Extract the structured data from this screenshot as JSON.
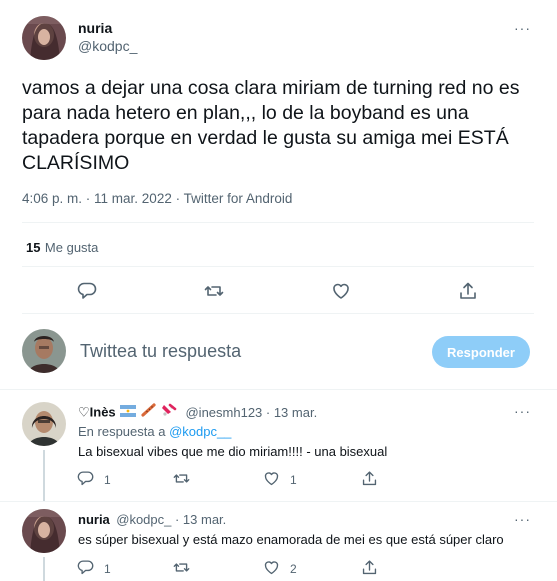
{
  "main_tweet": {
    "author_name": "nuria",
    "author_handle": "@kodpc_",
    "more": "···",
    "text": "vamos a dejar una cosa clara miriam de turning red no es para nada hetero en plan,,, lo de la boyband es una tapadera porque en verdad le gusta su amiga mei ESTÁ CLARÍSIMO",
    "timestamp": "4:06 p. m. · 11 mar. 2022 · Twitter for Android",
    "likes_count": "15",
    "likes_label": "Me gusta"
  },
  "compose": {
    "placeholder": "Twittea tu respuesta",
    "button_label": "Responder"
  },
  "replies": [
    {
      "name_prefix": "♡Inès",
      "handle_date": "@inesmh123 · 13 mar.",
      "replying_prefix": "En respuesta a ",
      "replying_mention": "@kodpc__",
      "text": "La bisexual vibes que me dio miriam!!!!  - una bisexual",
      "reply_count": "1",
      "like_count": "1",
      "more": "···"
    },
    {
      "name": "nuria",
      "handle_date": "@kodpc_ · 13 mar.",
      "text": "es súper bisexual y está mazo enamorada de mei es que está súper claro",
      "reply_count": "1",
      "like_count": "2",
      "more": "···"
    }
  ],
  "icons": {
    "reply": "comment-icon",
    "retweet": "retweet-icon",
    "like": "heart-icon",
    "share": "share-icon",
    "more": "more-icon"
  },
  "colors": {
    "accent": "#1d9bf0",
    "button_disabled": "#8ecdf8",
    "secondary_text": "#536471",
    "divider": "#eff3f4"
  }
}
